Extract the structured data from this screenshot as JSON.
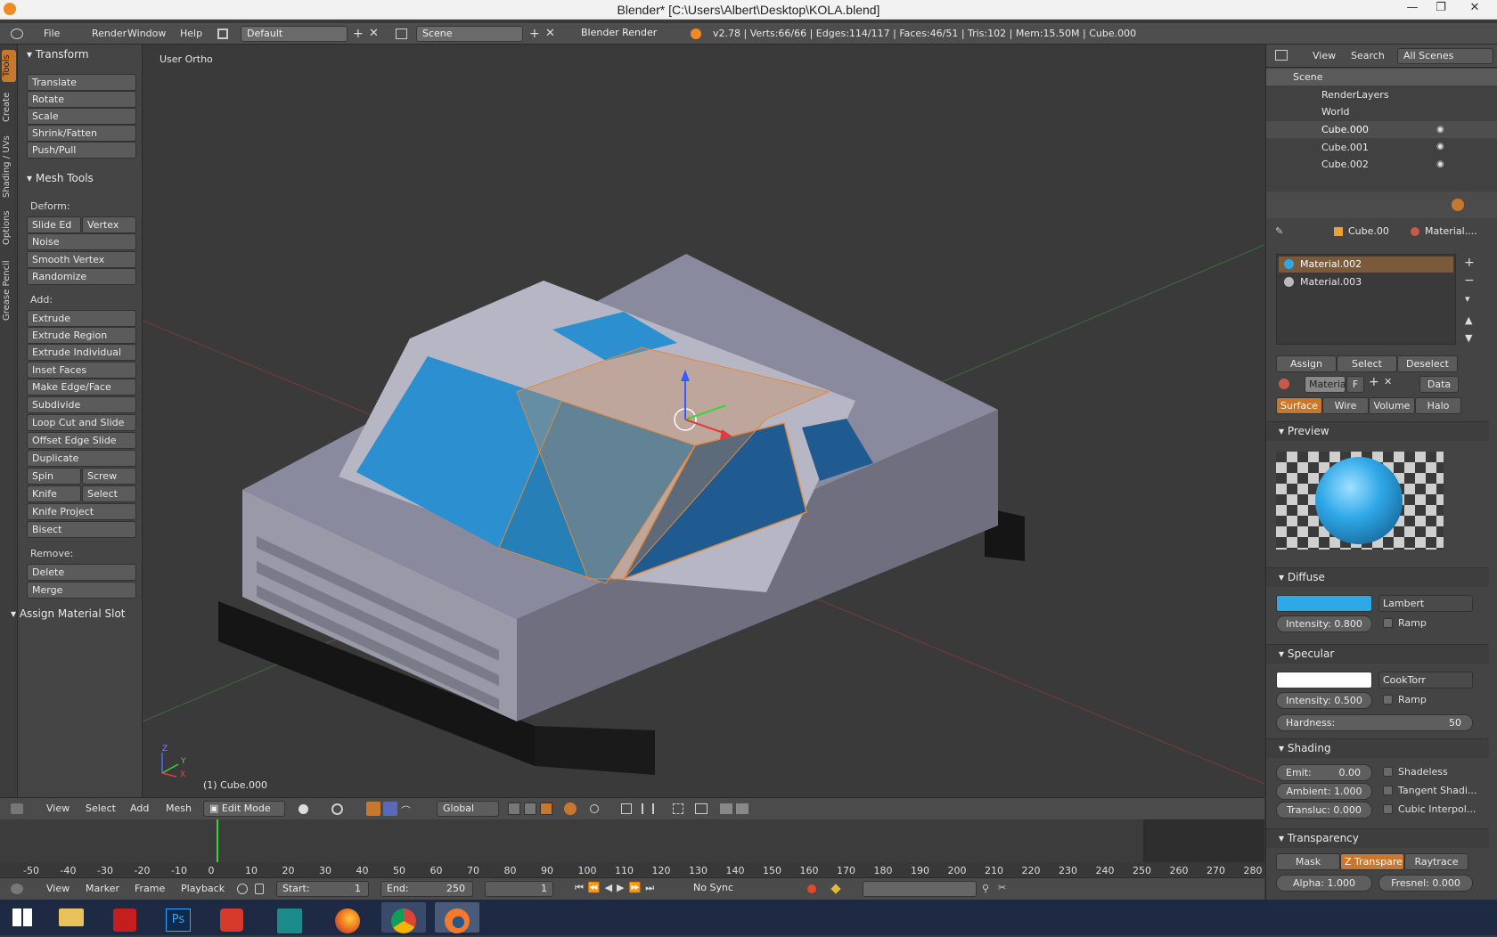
{
  "titlebar": {
    "title": "Blender* [C:\\Users\\Albert\\Desktop\\KOLA.blend]",
    "minimize": "—",
    "restore": "❐",
    "close": "✕"
  },
  "infobar": {
    "menus": [
      "File",
      "Render",
      "Window",
      "Help"
    ],
    "screen": "Default",
    "scene": "Scene",
    "engine": "Blender Render",
    "stats": "v2.78 | Verts:66/66 | Edges:114/117 | Faces:46/51 | Tris:102 | Mem:15.50M | Cube.000"
  },
  "tabs": [
    "Tools",
    "Create",
    "Shading / UVs",
    "Options",
    "Grease Pencil"
  ],
  "toolshelf": {
    "transform_header": "Transform",
    "transform": [
      "Translate",
      "Rotate",
      "Scale",
      "Shrink/Fatten",
      "Push/Pull"
    ],
    "meshtools_header": "Mesh Tools",
    "deform_label": "Deform:",
    "slide_edge": "Slide Ed",
    "vertex": "Vertex",
    "noise": "Noise",
    "smooth_vertex": "Smooth Vertex",
    "randomize": "Randomize",
    "add_label": "Add:",
    "extrude": "Extrude",
    "add": [
      "Extrude Region",
      "Extrude Individual",
      "Inset Faces",
      "Make Edge/Face",
      "Subdivide",
      "Loop Cut and Slide",
      "Offset Edge Slide",
      "Duplicate"
    ],
    "spin": "Spin",
    "screw": "Screw",
    "knife": "Knife",
    "select": "Select",
    "knife_project": "Knife Project",
    "bisect": "Bisect",
    "remove_label": "Remove:",
    "delete": "Delete",
    "merge": "Merge",
    "assign_material": "Assign Material Slot"
  },
  "viewport": {
    "view_label": "User Ortho",
    "object_label": "(1) Cube.000",
    "axis_x": "X",
    "axis_y": "Y",
    "axis_z": "Z"
  },
  "viewhdr": {
    "menus": [
      "View",
      "Select",
      "Add",
      "Mesh"
    ],
    "mode": "Edit Mode",
    "orientation": "Global"
  },
  "timeline": {
    "ticks": [
      "-50",
      "-40",
      "-30",
      "-20",
      "-10",
      "0",
      "10",
      "20",
      "30",
      "40",
      "50",
      "60",
      "70",
      "80",
      "90",
      "100",
      "110",
      "120",
      "130",
      "140",
      "150",
      "160",
      "170",
      "180",
      "190",
      "200",
      "210",
      "220",
      "230",
      "240",
      "250",
      "260",
      "270",
      "280"
    ]
  },
  "tlhdr": {
    "menus": [
      "View",
      "Marker",
      "Frame",
      "Playback"
    ],
    "start": "Start:",
    "start_val": "1",
    "end": "End:",
    "end_val": "250",
    "frame": "1",
    "sync": "No Sync"
  },
  "outliner": {
    "view": "View",
    "search": "Search",
    "filter": "All Scenes",
    "items": [
      "Scene",
      "RenderLayers",
      "World",
      "Cube.000",
      "Cube.001",
      "Cube.002"
    ]
  },
  "props": {
    "breadcrumb_obj": "Cube.00",
    "breadcrumb_mat": "Material....",
    "materials": [
      "Material.002",
      "Material.003"
    ],
    "assign": "Assign",
    "select": "Select",
    "deselect": "Deselect",
    "mat_name": "Material",
    "mat_f": "F",
    "data": "Data",
    "tabs": [
      "Surface",
      "Wire",
      "Volume",
      "Halo"
    ],
    "preview": "Preview",
    "diffuse": "Diffuse",
    "diffuse_shader": "Lambert",
    "diffuse_intensity": "Intensity: 0.800",
    "ramp": "Ramp",
    "specular": "Specular",
    "specular_shader": "CookTorr",
    "specular_intensity_label": "Intensity:",
    "specular_intensity": "0.500",
    "hardness_label": "Hardness:",
    "hardness": "50",
    "shading": "Shading",
    "emit_label": "Emit:",
    "emit": "0.00",
    "ambient": "Ambient: 1.000",
    "transluc": "Transluc: 0.000",
    "shadeless": "Shadeless",
    "tangent": "Tangent Shadi...",
    "cubic": "Cubic Interpol...",
    "transparency": "Transparency",
    "mask": "Mask",
    "ztransp": "Z Transpare...",
    "raytrace": "Raytrace",
    "alpha": "Alpha:  1.000",
    "fresnel": "Fresnel:  0.000"
  },
  "colors": {
    "diffuse": "#2fa8e8",
    "specular": "#ffffff",
    "accent": "#c8782e"
  },
  "taskbar": {
    "apps": [
      "windows-start-icon",
      "file-explorer-icon",
      "acrobat-icon",
      "photoshop-icon",
      "sketchup-icon",
      "maya-icon",
      "firefox-icon",
      "chrome-icon",
      "blender-icon"
    ],
    "ps": "Ps"
  }
}
